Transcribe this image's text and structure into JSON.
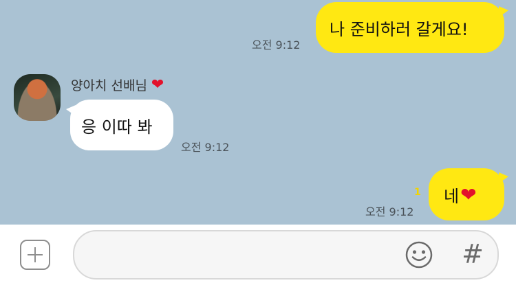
{
  "messages": [
    {
      "side": "me",
      "text": "나 준비하러 갈게요!",
      "time": "오전 9:12"
    },
    {
      "side": "other",
      "sender": "양아치 선배님",
      "sender_suffix_icon": "red-heart",
      "text": "응 이따 봐",
      "time": "오전 9:12"
    },
    {
      "side": "me",
      "text": "네",
      "text_suffix_icon": "red-heart",
      "unread_count": "1",
      "time": "오전 9:12"
    }
  ],
  "input": {
    "placeholder": "",
    "value": ""
  },
  "icons": {
    "add": "plus-square-icon",
    "emoji": "smiley-icon",
    "hash": "#"
  },
  "colors": {
    "chat_bg": "#aac2d3",
    "my_bubble": "#ffe812",
    "other_bubble": "#ffffff",
    "heart": "#e3112b"
  }
}
